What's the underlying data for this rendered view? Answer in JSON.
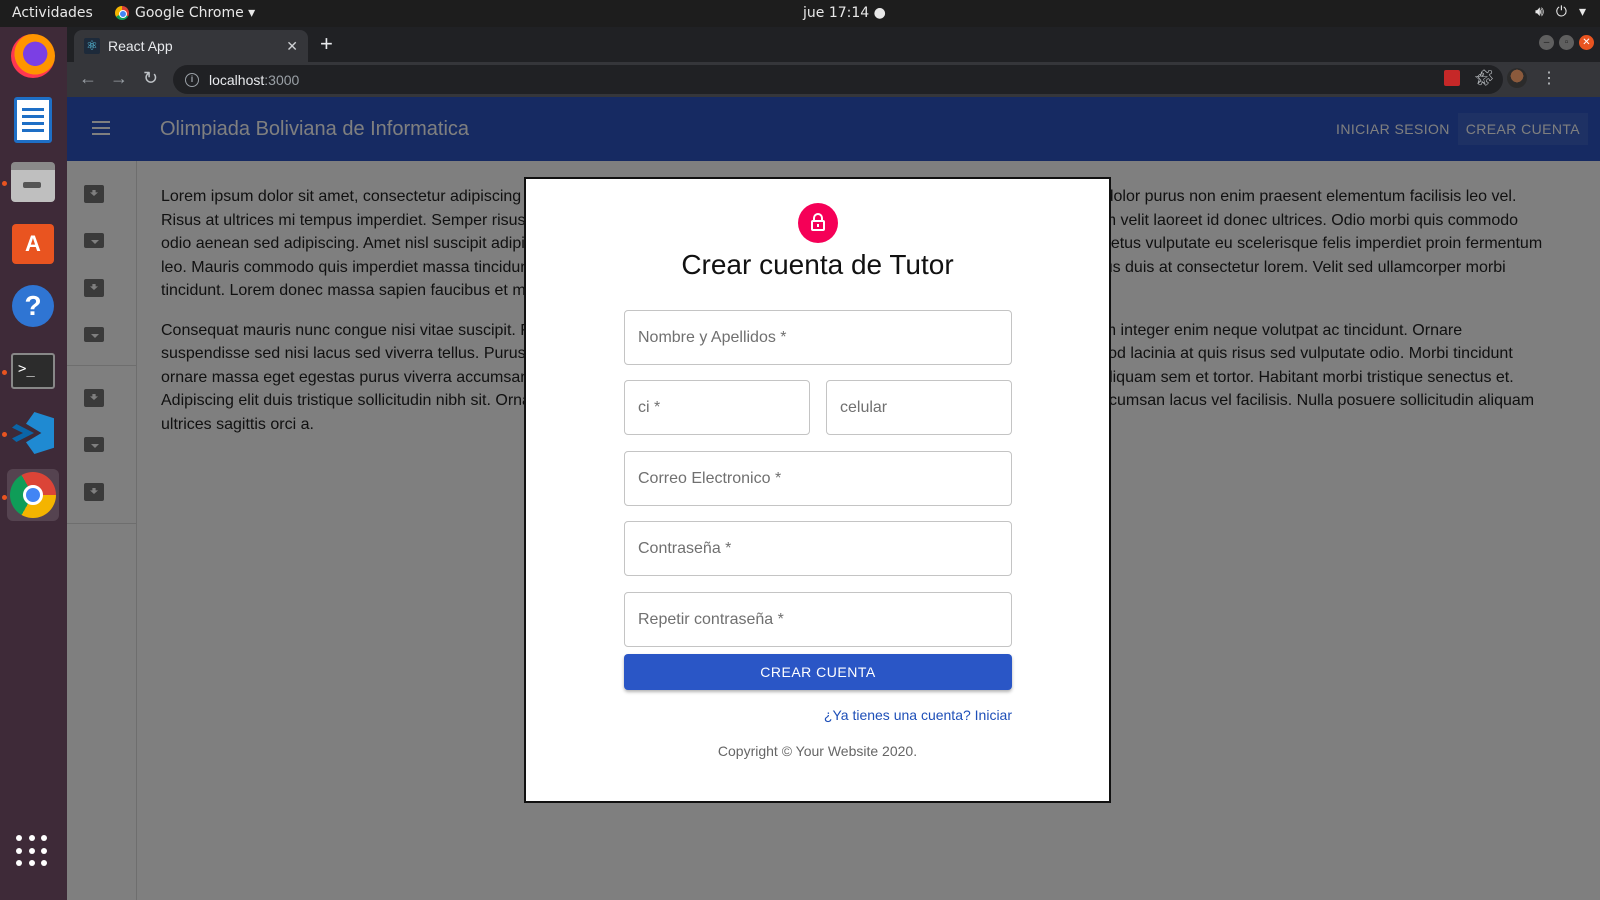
{
  "os": {
    "activities": "Actividades",
    "app_menu": "Google Chrome ▾",
    "clock": "jue 17:14 ●",
    "sys_icons": [
      "volume-icon",
      "power-icon"
    ]
  },
  "dock": {
    "items": [
      "firefox",
      "libreoffice-writer",
      "files",
      "software-center",
      "help",
      "terminal",
      "vscode",
      "chrome",
      "show-apps"
    ]
  },
  "browser": {
    "tab_title": "React App",
    "tab_close": "✕",
    "new_tab": "+",
    "url_host": "localhost",
    "url_port": ":3000"
  },
  "app": {
    "title": "Olimpiada Boliviana de Informatica",
    "nav_login": "INICIAR SESION",
    "nav_signup": "CREAR CUENTA",
    "accent": "#2c55c4"
  },
  "content": {
    "paragraph1": "Lorem ipsum dolor sit amet, consectetur adipiscing elit, sed do eiusmod tempor incididunt ut labore et dolore magna aliqua. Rhoncus dolor purus non enim praesent elementum facilisis leo vel. Risus at ultrices mi tempus imperdiet. Semper risus in hendrerit gravida rutrum quisque non tellus. Convallis convallis tellus id interdum velit laoreet id donec ultrices. Odio morbi quis commodo odio aenean sed adipiscing. Amet nisl suscipit adipiscing bibendum est ultricies integer quis. Cursus euismod quis viverra nibh cras. Metus vulputate eu scelerisque felis imperdiet proin fermentum leo. Mauris commodo quis imperdiet massa tincidunt. Cras tincidunt lobortis feugiat vivamus at augue. At augue eget arcu dictum varius duis at consectetur lorem. Velit sed ullamcorper morbi tincidunt. Lorem donec massa sapien faucibus et molestie ac.",
    "paragraph2": "Consequat mauris nunc congue nisi vitae suscipit. Fringilla est ullamcorper eget nulla facilisi etiam dignissim diam. Pulvinar elementum integer enim neque volutpat ac tincidunt. Ornare suspendisse sed nisi lacus sed viverra tellus. Purus sit amet volutpat consequat mauris. Elementum eu facilisis sed odio morbi. Euismod lacinia at quis risus sed vulputate odio. Morbi tincidunt ornare massa eget egestas purus viverra accumsan in. In hendrerit gravida rutrum quisque non tellus orci ac. Pellentesque nec nam aliquam sem et tortor. Habitant morbi tristique senectus et. Adipiscing elit duis tristique sollicitudin nibh sit. Ornare aenean euismod elementum nisi quis eleifend. Commodo viverra maecenas accumsan lacus vel facilisis. Nulla posuere sollicitudin aliquam ultrices sagittis orci a."
  },
  "modal": {
    "title": "Crear cuenta de Tutor",
    "fields": {
      "full_name": "Nombre y Apellidos *",
      "ci": "ci *",
      "phone": "celular",
      "email": "Correo Electronico *",
      "password": "Contraseña *",
      "password_repeat": "Repetir contraseña *"
    },
    "submit": "CREAR CUENTA",
    "signin_link": "¿Ya tienes una cuenta? Iniciar",
    "copyright": "Copyright © Your Website 2020.",
    "avatar_color": "#f50057"
  }
}
